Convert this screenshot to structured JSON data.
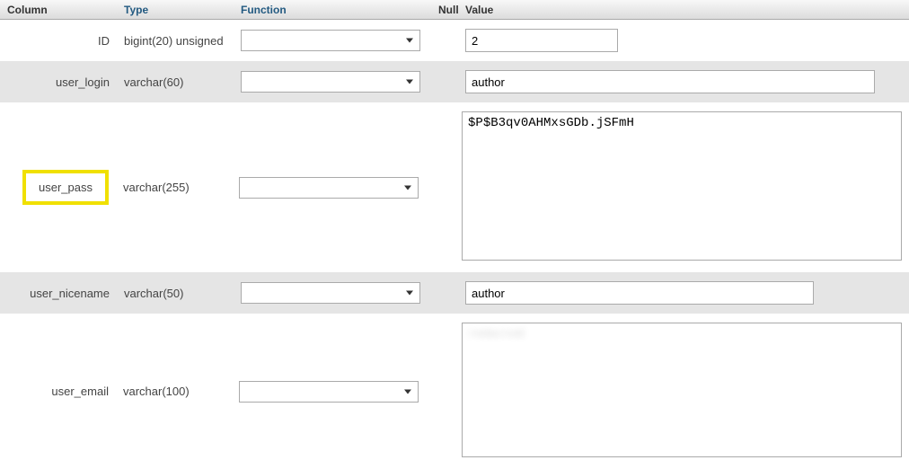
{
  "headers": {
    "column": "Column",
    "type": "Type",
    "function": "Function",
    "null": "Null",
    "value": "Value"
  },
  "rows": [
    {
      "column": "ID",
      "type": "bigint(20) unsigned",
      "function": "",
      "value": "2",
      "input_kind": "text_short",
      "highlight": false
    },
    {
      "column": "user_login",
      "type": "varchar(60)",
      "function": "",
      "value": "author",
      "input_kind": "text_wide",
      "highlight": false
    },
    {
      "column": "user_pass",
      "type": "varchar(255)",
      "function": "",
      "value": "$P$B3qv0AHMxsGDb.jSFmH",
      "input_kind": "textarea",
      "highlight": true
    },
    {
      "column": "user_nicename",
      "type": "varchar(50)",
      "function": "",
      "value": "author",
      "input_kind": "text_medium",
      "highlight": false
    },
    {
      "column": "user_email",
      "type": "varchar(100)",
      "function": "",
      "value": "",
      "input_kind": "textarea_blur",
      "highlight": false
    }
  ]
}
